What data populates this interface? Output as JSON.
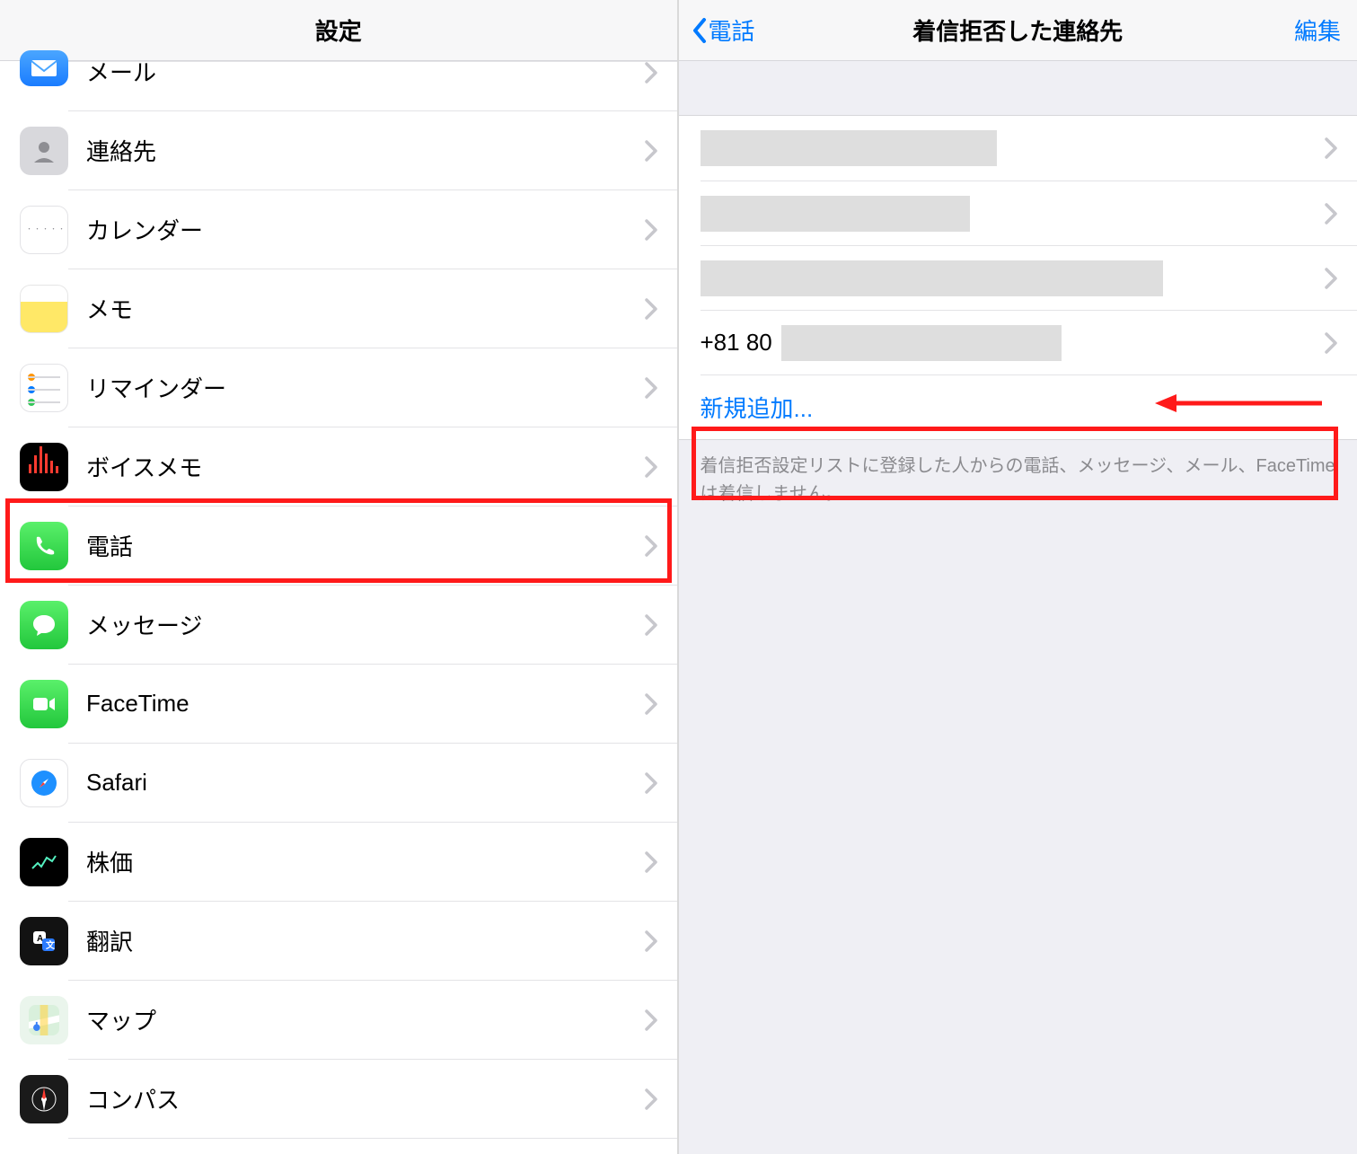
{
  "left": {
    "title": "設定",
    "items": [
      {
        "label": "メール",
        "icon": "mail"
      },
      {
        "label": "連絡先",
        "icon": "contacts"
      },
      {
        "label": "カレンダー",
        "icon": "calendar"
      },
      {
        "label": "メモ",
        "icon": "notes"
      },
      {
        "label": "リマインダー",
        "icon": "reminders"
      },
      {
        "label": "ボイスメモ",
        "icon": "voice"
      },
      {
        "label": "電話",
        "icon": "phone"
      },
      {
        "label": "メッセージ",
        "icon": "messages"
      },
      {
        "label": "FaceTime",
        "icon": "facetime"
      },
      {
        "label": "Safari",
        "icon": "safari"
      },
      {
        "label": "株価",
        "icon": "stocks"
      },
      {
        "label": "翻訳",
        "icon": "translate"
      },
      {
        "label": "マップ",
        "icon": "maps"
      },
      {
        "label": "コンパス",
        "icon": "compass"
      }
    ],
    "highlight_index": 6
  },
  "right": {
    "back_label": "電話",
    "title": "着信拒否した連絡先",
    "edit_label": "編集",
    "contacts": [
      {
        "display": "",
        "redact": "only"
      },
      {
        "display": "",
        "redact": "mid"
      },
      {
        "display": "",
        "redact": "wide"
      },
      {
        "display": "+81 80",
        "redact": "num"
      }
    ],
    "add_label": "新規追加...",
    "footer": "着信拒否設定リストに登録した人からの電話、メッセージ、メール、FaceTimeは着信しません。",
    "arrow_on_index": 3,
    "highlight_add": true
  },
  "colors": {
    "accent": "#007aff",
    "highlight_border": "#ff1a1a"
  }
}
